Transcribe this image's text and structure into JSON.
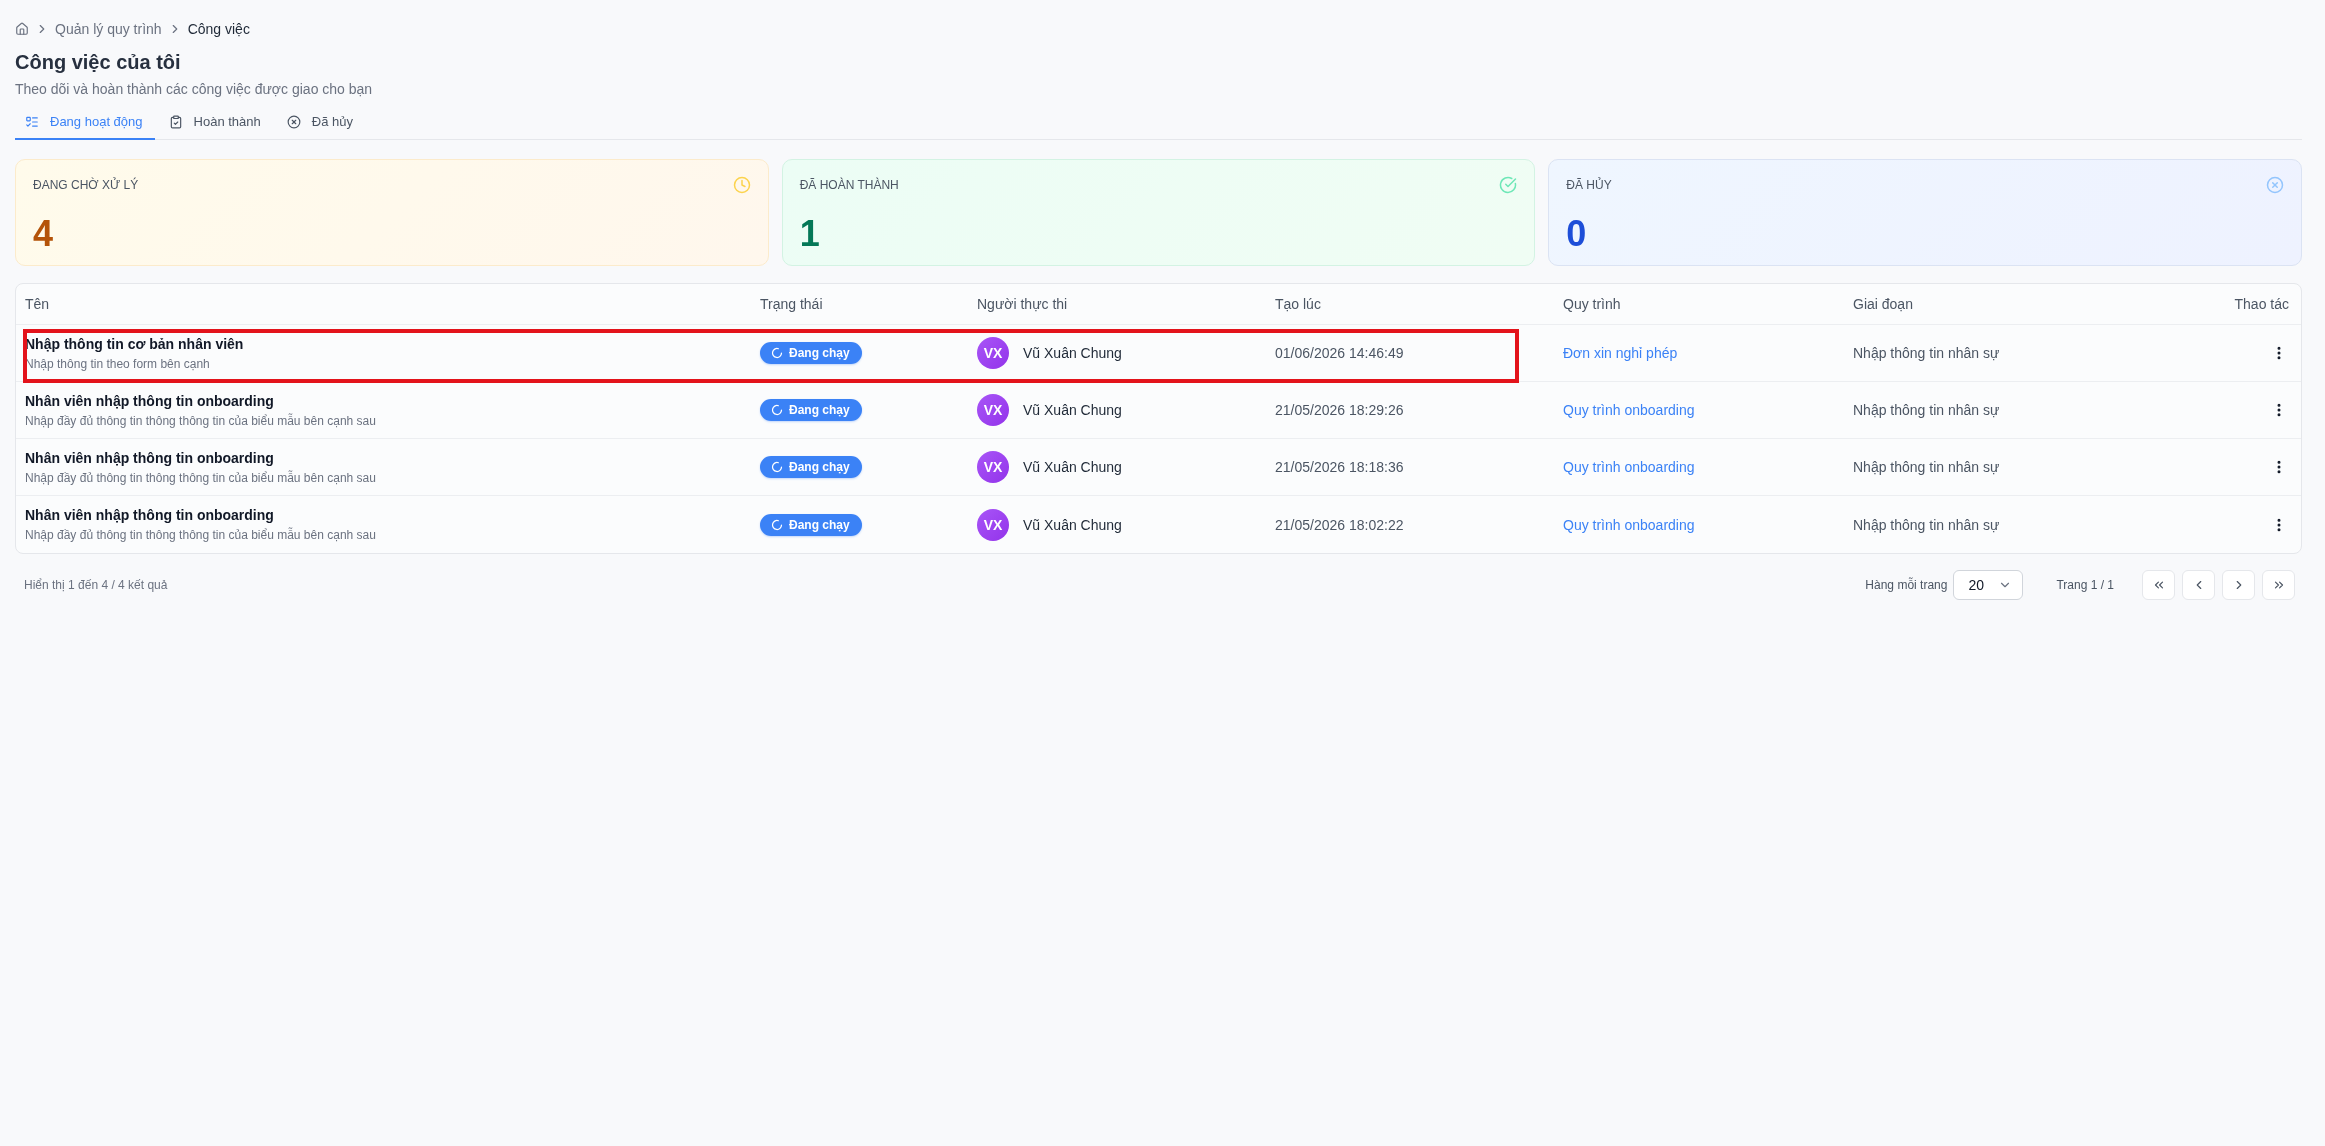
{
  "breadcrumb": [
    {
      "label": "Quản lý quy trình",
      "current": false
    },
    {
      "label": "Công việc",
      "current": true
    }
  ],
  "page": {
    "title": "Công việc của tôi",
    "subtitle": "Theo dõi và hoàn thành các công việc được giao cho bạn"
  },
  "tabs": [
    {
      "label": "Đang hoạt động",
      "selected": true
    },
    {
      "label": "Hoàn thành",
      "selected": false
    },
    {
      "label": "Đã hủy",
      "selected": false
    }
  ],
  "stats": [
    {
      "kind": "pending",
      "label": "ĐANG CHỜ XỬ LÝ",
      "value": "4"
    },
    {
      "kind": "done",
      "label": "ĐÃ HOÀN THÀNH",
      "value": "1"
    },
    {
      "kind": "cancelled",
      "label": "ĐÃ HỦY",
      "value": "0"
    }
  ],
  "table": {
    "columns": [
      "Tên",
      "Trạng thái",
      "Người thực thi",
      "Tạo lúc",
      "Quy trình",
      "Giai đoạn",
      "Thao tác"
    ],
    "rows": [
      {
        "title": "Nhập thông tin cơ bản nhân viên",
        "description": "Nhập thông tin theo form bên cạnh",
        "status": "Đang chạy",
        "assignee_initials": "VX",
        "assignee": "Vũ Xuân Chung",
        "created": "01/06/2026 14:46:49",
        "process": "Đơn xin nghỉ phép",
        "stage": "Nhập thông tin nhân sự",
        "highlighted": true
      },
      {
        "title": "Nhân viên nhập thông tin onboarding",
        "description": "Nhập đầy đủ thông tin thông thông tin của biểu mẫu bên cạnh sau",
        "status": "Đang chạy",
        "assignee_initials": "VX",
        "assignee": "Vũ Xuân Chung",
        "created": "21/05/2026 18:29:26",
        "process": "Quy trình onboarding",
        "stage": "Nhập thông tin nhân sự",
        "highlighted": false
      },
      {
        "title": "Nhân viên nhập thông tin onboarding",
        "description": "Nhập đầy đủ thông tin thông thông tin của biểu mẫu bên cạnh sau",
        "status": "Đang chạy",
        "assignee_initials": "VX",
        "assignee": "Vũ Xuân Chung",
        "created": "21/05/2026 18:18:36",
        "process": "Quy trình onboarding",
        "stage": "Nhập thông tin nhân sự",
        "highlighted": false
      },
      {
        "title": "Nhân viên nhập thông tin onboarding",
        "description": "Nhập đầy đủ thông tin thông thông tin của biểu mẫu bên cạnh sau",
        "status": "Đang chạy",
        "assignee_initials": "VX",
        "assignee": "Vũ Xuân Chung",
        "created": "21/05/2026 18:02:22",
        "process": "Quy trình onboarding",
        "stage": "Nhập thông tin nhân sự",
        "highlighted": false
      }
    ]
  },
  "footer": {
    "summary": "Hiển thị 1 đến 4 / 4 kết quả",
    "rows_per_page_label": "Hàng mỗi trang",
    "rows_per_page": "20",
    "page_info": "Trang 1 / 1"
  }
}
